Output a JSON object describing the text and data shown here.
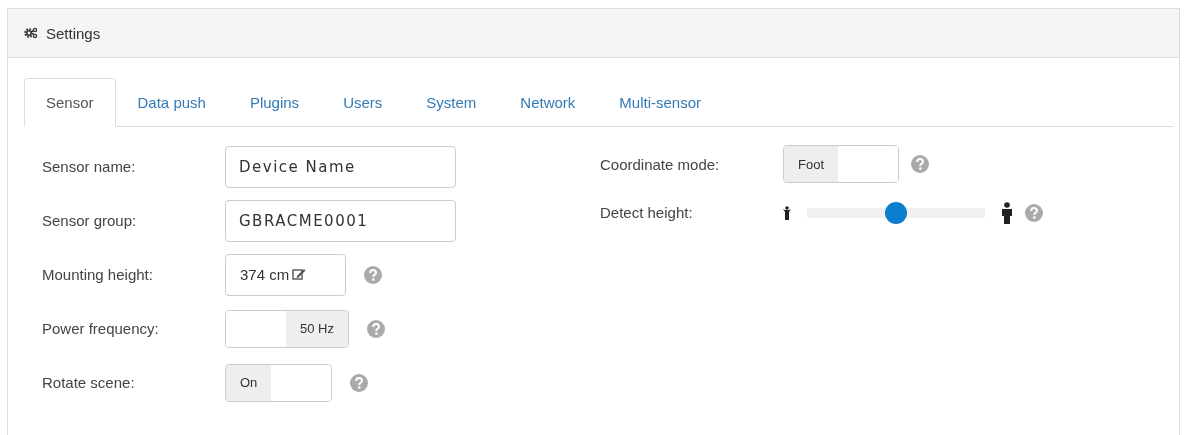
{
  "panel": {
    "title": "Settings"
  },
  "tabs": [
    {
      "label": "Sensor",
      "selected": true
    },
    {
      "label": "Data push",
      "selected": false
    },
    {
      "label": "Plugins",
      "selected": false
    },
    {
      "label": "Users",
      "selected": false
    },
    {
      "label": "System",
      "selected": false
    },
    {
      "label": "Network",
      "selected": false
    },
    {
      "label": "Multi-sensor",
      "selected": false
    }
  ],
  "left_fields": [
    {
      "kind": "text",
      "label": "Sensor name:",
      "value": "Device Name",
      "help": false
    },
    {
      "kind": "text",
      "label": "Sensor group:",
      "value": "GBRACME0001",
      "help": false
    },
    {
      "kind": "edit",
      "label": "Mounting height:",
      "value": "374 cm",
      "help": true
    },
    {
      "kind": "switch",
      "label": "Power frequency:",
      "value": "50 Hz",
      "on": false,
      "help": true
    },
    {
      "kind": "switch",
      "label": "Rotate scene:",
      "value": "On",
      "on": true,
      "help": true
    }
  ],
  "right_fields": [
    {
      "kind": "switch",
      "label": "Coordinate mode:",
      "value": "Foot",
      "on": true,
      "help": true
    },
    {
      "kind": "slider",
      "label": "Detect height:",
      "level": 0.5,
      "help": true
    }
  ]
}
